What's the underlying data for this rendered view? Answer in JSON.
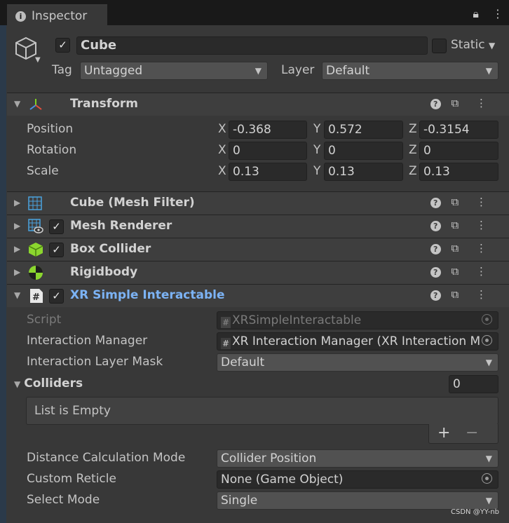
{
  "tab": {
    "title": "Inspector"
  },
  "object": {
    "name": "Cube",
    "static_label": "Static",
    "tag_label": "Tag",
    "tag_value": "Untagged",
    "layer_label": "Layer",
    "layer_value": "Default"
  },
  "transform": {
    "title": "Transform",
    "rows": [
      {
        "label": "Position",
        "x": "-0.368",
        "y": "0.572",
        "z": "-0.3154"
      },
      {
        "label": "Rotation",
        "x": "0",
        "y": "0",
        "z": "0"
      },
      {
        "label": "Scale",
        "x": "0.13",
        "y": "0.13",
        "z": "0.13"
      }
    ],
    "axis_x": "X",
    "axis_y": "Y",
    "axis_z": "Z"
  },
  "components": [
    {
      "title": "Cube (Mesh Filter)"
    },
    {
      "title": "Mesh Renderer"
    },
    {
      "title": "Box Collider"
    },
    {
      "title": "Rigidbody"
    },
    {
      "title": "XR Simple Interactable"
    }
  ],
  "xr": {
    "script_label": "Script",
    "script_value": "XRSimpleInteractable",
    "manager_label": "Interaction Manager",
    "manager_value": "XR Interaction Manager (XR Interaction M",
    "layer_mask_label": "Interaction Layer Mask",
    "layer_mask_value": "Default",
    "colliders_label": "Colliders",
    "colliders_count": "0",
    "list_empty": "List is Empty",
    "distance_label": "Distance Calculation Mode",
    "distance_value": "Collider Position",
    "reticle_label": "Custom Reticle",
    "reticle_value": "None (Game Object)",
    "select_label": "Select Mode",
    "select_value": "Single"
  },
  "watermark": "CSDN @YY-nb",
  "colors": {
    "bg": "#383838",
    "field": "#2a2a2a",
    "header": "#3e3e3e",
    "accent": "#7cb3f5",
    "checkbox": "#e6e6e6"
  }
}
